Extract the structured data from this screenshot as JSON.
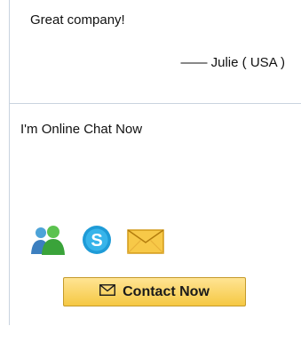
{
  "testimonial": {
    "quote": "Great company!",
    "author": "—— Julie ( USA )"
  },
  "chat": {
    "title": "I'm Online Chat Now",
    "icons": [
      "msn-messenger-icon",
      "skype-icon",
      "email-envelope-icon"
    ],
    "contact_label": "Contact Now"
  },
  "colors": {
    "divider": "#c9d3df",
    "button_top": "#ffe493",
    "button_bottom": "#f5c843",
    "button_border": "#c49a2a",
    "skype_blue": "#1e9bd7",
    "msn_green": "#3aa33a",
    "envelope_yellow": "#f7c948"
  }
}
